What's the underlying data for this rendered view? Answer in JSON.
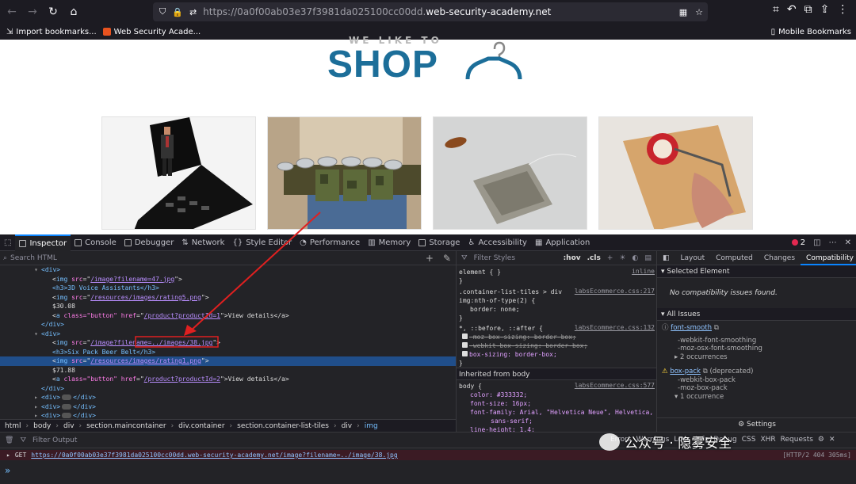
{
  "browser": {
    "url_prefix": "https://0a0f00ab03e37f3981da025100cc00dd.",
    "url_host": "web-security-academy.net",
    "bookmarks": [
      "Import bookmarks...",
      "Web Security Acade..."
    ],
    "mobile_bookmarks": "Mobile Bookmarks"
  },
  "page": {
    "tagline": "WE LIKE TO",
    "logo": "SHOP"
  },
  "devtools": {
    "tabs": [
      "Inspector",
      "Console",
      "Debugger",
      "Network",
      "Style Editor",
      "Performance",
      "Memory",
      "Storage",
      "Accessibility",
      "Application"
    ],
    "error_count": "2",
    "search_placeholder": "Search HTML",
    "html_lines": [
      {
        "indent": 52,
        "t": "<div>"
      },
      {
        "indent": 66,
        "tag": "img",
        "attr": "src",
        "val": "/image?filename=47.jpg"
      },
      {
        "indent": 66,
        "t": "<h3>3D Voice Assistants</h3>"
      },
      {
        "indent": 66,
        "tag": "img",
        "attr": "src",
        "val": "/resources/images/rating5.png"
      },
      {
        "indent": 66,
        "t": "$30.08"
      },
      {
        "indent": 66,
        "tag": "a",
        "attr": "class=\"button\" href",
        "val": "/product?productId=1",
        "tail": "View details</a>"
      },
      {
        "indent": 52,
        "t": "</div>"
      },
      {
        "indent": 52,
        "t": "<div>"
      },
      {
        "indent": 66,
        "tag": "img",
        "attr": "src",
        "val": "/image?filename=../images/38.jpg"
      },
      {
        "indent": 66,
        "t": "<h3>Six Pack Beer Belt</h3>"
      },
      {
        "indent": 66,
        "tag": "img",
        "attr": "src",
        "val": "/resources/images/rating1.png",
        "selected": true
      },
      {
        "indent": 66,
        "t": "$71.88"
      },
      {
        "indent": 66,
        "tag": "a",
        "attr": "class=\"button\" href",
        "val": "/product?productId=2",
        "tail": "View details</a>"
      },
      {
        "indent": 52,
        "t": "</div>"
      },
      {
        "indent": 52,
        "t": "<div>",
        "collapsed": true
      },
      {
        "indent": 52,
        "t": "<div>",
        "collapsed": true
      },
      {
        "indent": 52,
        "t": "<div>",
        "collapsed": true
      }
    ],
    "breadcrumbs": [
      "html",
      "body",
      "div",
      "section.maincontainer",
      "div.container",
      "section.container-list-tiles",
      "div",
      "img"
    ],
    "styles": {
      "filter_placeholder": "Filter Styles",
      "hov": ":hov",
      "cls": ".cls",
      "element_rule": "element { }",
      "inline": "inline",
      "rule1_selector": ".container-list-tiles > div img:nth-of-type(2)",
      "rule1_selector_a": ".container-list-tiles > div",
      "rule1_selector_b": "img:nth-of-type(2) {",
      "rule1_source": "labsEcommerce.css:217",
      "rule1_decl": "border: none;",
      "rule2_selector": "*, ::before, ::after {",
      "rule2_source": "labsEcommerce.css:132",
      "rule2_decls": [
        "-moz-box-sizing: border-box;",
        "-webkit-box-sizing: border-box;",
        "box-sizing: border-box;"
      ],
      "inherited": "Inherited from body",
      "rule3_selector": "body {",
      "rule3_source": "labsEcommerce.css:577",
      "rule3_decls": [
        "color: #333332;",
        "font-size: 16px;",
        "font-family: Arial, \"Helvetica Neue\", Helvetica,",
        "sans-serif;",
        "line-height: 1.4;",
        "overflow-wrap: break-word;"
      ]
    },
    "side_tabs": [
      "Layout",
      "Computed",
      "Changes",
      "Compatibility"
    ],
    "compat": {
      "selected_header": "Selected Element",
      "no_issues": "No compatibility issues found.",
      "all_header": "All Issues",
      "issue1": "font-smooth",
      "issue1_list": [
        "-webkit-font-smoothing",
        "-moz-osx-font-smoothing"
      ],
      "issue1_occ": "2 occurrences",
      "issue2": "box-pack",
      "issue2_note": "(deprecated)",
      "issue2_list": [
        "-webkit-box-pack",
        "-moz-box-pack"
      ],
      "issue2_occ": "1 occurrence",
      "settings": "Settings"
    },
    "console": {
      "filter_placeholder": "Filter Output",
      "filters": [
        "Errors",
        "Warnings",
        "Logs",
        "Info",
        "Debug",
        "CSS",
        "XHR",
        "Requests"
      ],
      "method": "GET",
      "url": "https://0a0f00ab03e37f3981da025100cc00dd.web-security-academy.net/image?filename=../image/38.jpg",
      "timing": "[HTTP/2 404 305ms]"
    }
  },
  "watermark": "公众号 · 隐雾安全",
  "colors": {
    "accent": "#0a84ff",
    "logo": "#1c6e99",
    "annotation": "#e02020"
  }
}
